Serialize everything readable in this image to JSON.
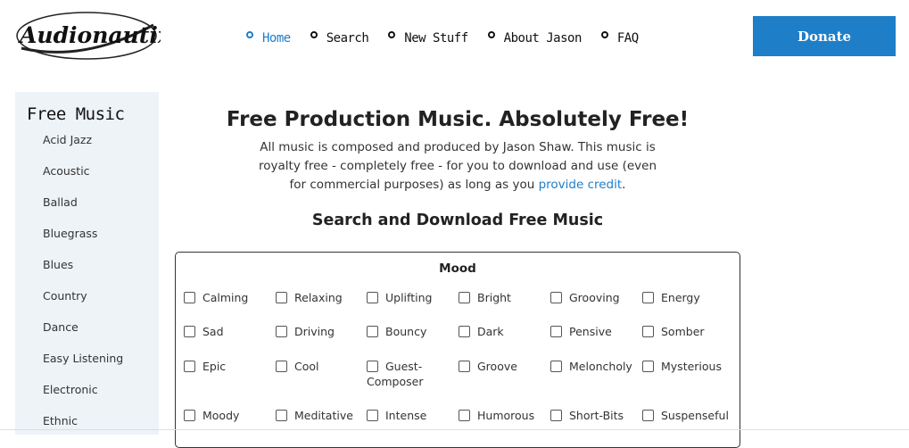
{
  "logo": {
    "text": "Audionautix"
  },
  "nav": [
    {
      "label": "Home",
      "active": true
    },
    {
      "label": "Search",
      "active": false
    },
    {
      "label": "New Stuff",
      "active": false
    },
    {
      "label": "About Jason",
      "active": false
    },
    {
      "label": "FAQ",
      "active": false
    }
  ],
  "donate_label": "Donate",
  "sidebar": {
    "title": "Free Music",
    "items": [
      "Acid Jazz",
      "Acoustic",
      "Ballad",
      "Bluegrass",
      "Blues",
      "Country",
      "Dance",
      "Easy Listening",
      "Electronic",
      "Ethnic"
    ]
  },
  "main": {
    "title": "Free Production Music. Absolutely Free!",
    "intro_text": "All music is composed and produced by Jason Shaw. This music is royalty free - completely free - for you to download and use (even for commercial purposes) as long as you ",
    "intro_link": "provide credit",
    "intro_end": ".",
    "search_title": "Search and Download Free Music"
  },
  "mood": {
    "title": "Mood",
    "rows": [
      [
        "Calming",
        "Relaxing",
        "Uplifting",
        "Bright",
        "Grooving",
        "Energy"
      ],
      [
        "Sad",
        "Driving",
        "Bouncy",
        "Dark",
        "Pensive",
        "Somber"
      ],
      [
        "Epic",
        "Cool",
        "Guest-Composer",
        "Groove",
        "Meloncholy",
        "Mysterious"
      ],
      [
        "Moody",
        "Meditative",
        "Intense",
        "Humorous",
        "Short-Bits",
        "Suspenseful"
      ]
    ]
  },
  "colors": {
    "accent": "#1e7ec8",
    "sidebar_bg": "#eef3f8"
  }
}
